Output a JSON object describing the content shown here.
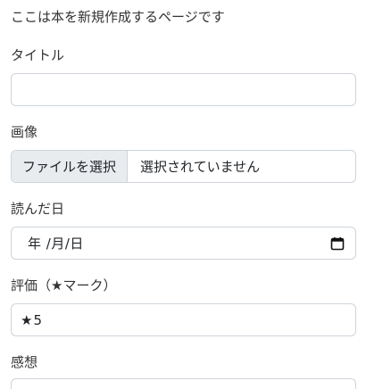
{
  "intro_text": "ここは本を新規作成するページです",
  "title_field": {
    "label": "タイトル",
    "value": ""
  },
  "image_field": {
    "label": "画像",
    "button_label": "ファイルを選択",
    "status_text": "選択されていません"
  },
  "read_date_field": {
    "label": "読んだ日",
    "display": "年 /月/日",
    "icon": "calendar-icon"
  },
  "rating_field": {
    "label": "評価（★マーク）",
    "star": "★",
    "value": "5"
  },
  "impression_field": {
    "label": "感想"
  }
}
